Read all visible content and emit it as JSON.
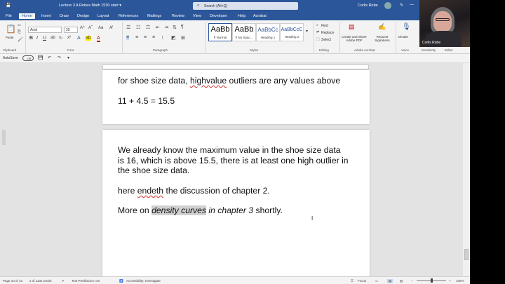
{
  "titlebar": {
    "doc_title": "Lecture 3 A Robes Math 1530 start ▾",
    "search_placeholder": "Search (Alt+Q)",
    "user_name": "Corlis Robe"
  },
  "tabs": [
    "File",
    "Home",
    "Insert",
    "Draw",
    "Design",
    "Layout",
    "References",
    "Mailings",
    "Review",
    "View",
    "Developer",
    "Help",
    "Acrobat"
  ],
  "active_tab": "Home",
  "ribbon": {
    "clipboard": {
      "paste": "Paste",
      "label": "Clipboard"
    },
    "font": {
      "name": "Arial",
      "size": "20",
      "label": "Font"
    },
    "paragraph": {
      "label": "Paragraph"
    },
    "styles": {
      "label": "Styles",
      "items": [
        {
          "preview": "AaBb",
          "name": "¶ Normal"
        },
        {
          "preview": "AaBb",
          "name": "¶ No Spac..."
        },
        {
          "preview": "AaBbCc",
          "name": "Heading 1"
        },
        {
          "preview": "AaBbCcC",
          "name": "Heading 2"
        }
      ]
    },
    "editing": {
      "find": "Find",
      "replace": "Replace",
      "select": "Select",
      "label": "Editing"
    },
    "acrobat": {
      "create": "Create and Share Adobe PDF",
      "request": "Request Signatures",
      "label": "Adobe Acrobat"
    },
    "voice": {
      "dictate": "Dictate",
      "label": "Voice"
    },
    "sensitivity": {
      "label": "Sensitivity"
    },
    "editor": {
      "label": "Editor"
    }
  },
  "qat": {
    "autosave": "AutoSave",
    "toggle": "Off"
  },
  "document": {
    "page1": {
      "line1_pre": "for shoe size data, ",
      "line1_err": "highvalue",
      "line1_post": " outliers are any values above",
      "line2": "11 + 4.5 = 15.5"
    },
    "page2": {
      "para1": [
        "We already know the maximum value in the shoe size data",
        "is 16, which is above 15.5, there is at least one high outlier in",
        "the shoe size data."
      ],
      "para2_pre": "here ",
      "para2_err": "endeth",
      "para2_post": " the discussion of chapter 2.",
      "para3_pre": "More on ",
      "para3_hl": "density curves",
      "para3_it": " in chapter 3",
      "para3_post": " shortly."
    }
  },
  "statusbar": {
    "page": "Page 10 of 10",
    "words": "2 of 1132 words",
    "predictions": "Text Predictions: On",
    "accessibility": "Accessibility: Investigate",
    "focus": "Focus",
    "zoom": "100%"
  },
  "webcam": {
    "name": "Corlis Robe"
  }
}
